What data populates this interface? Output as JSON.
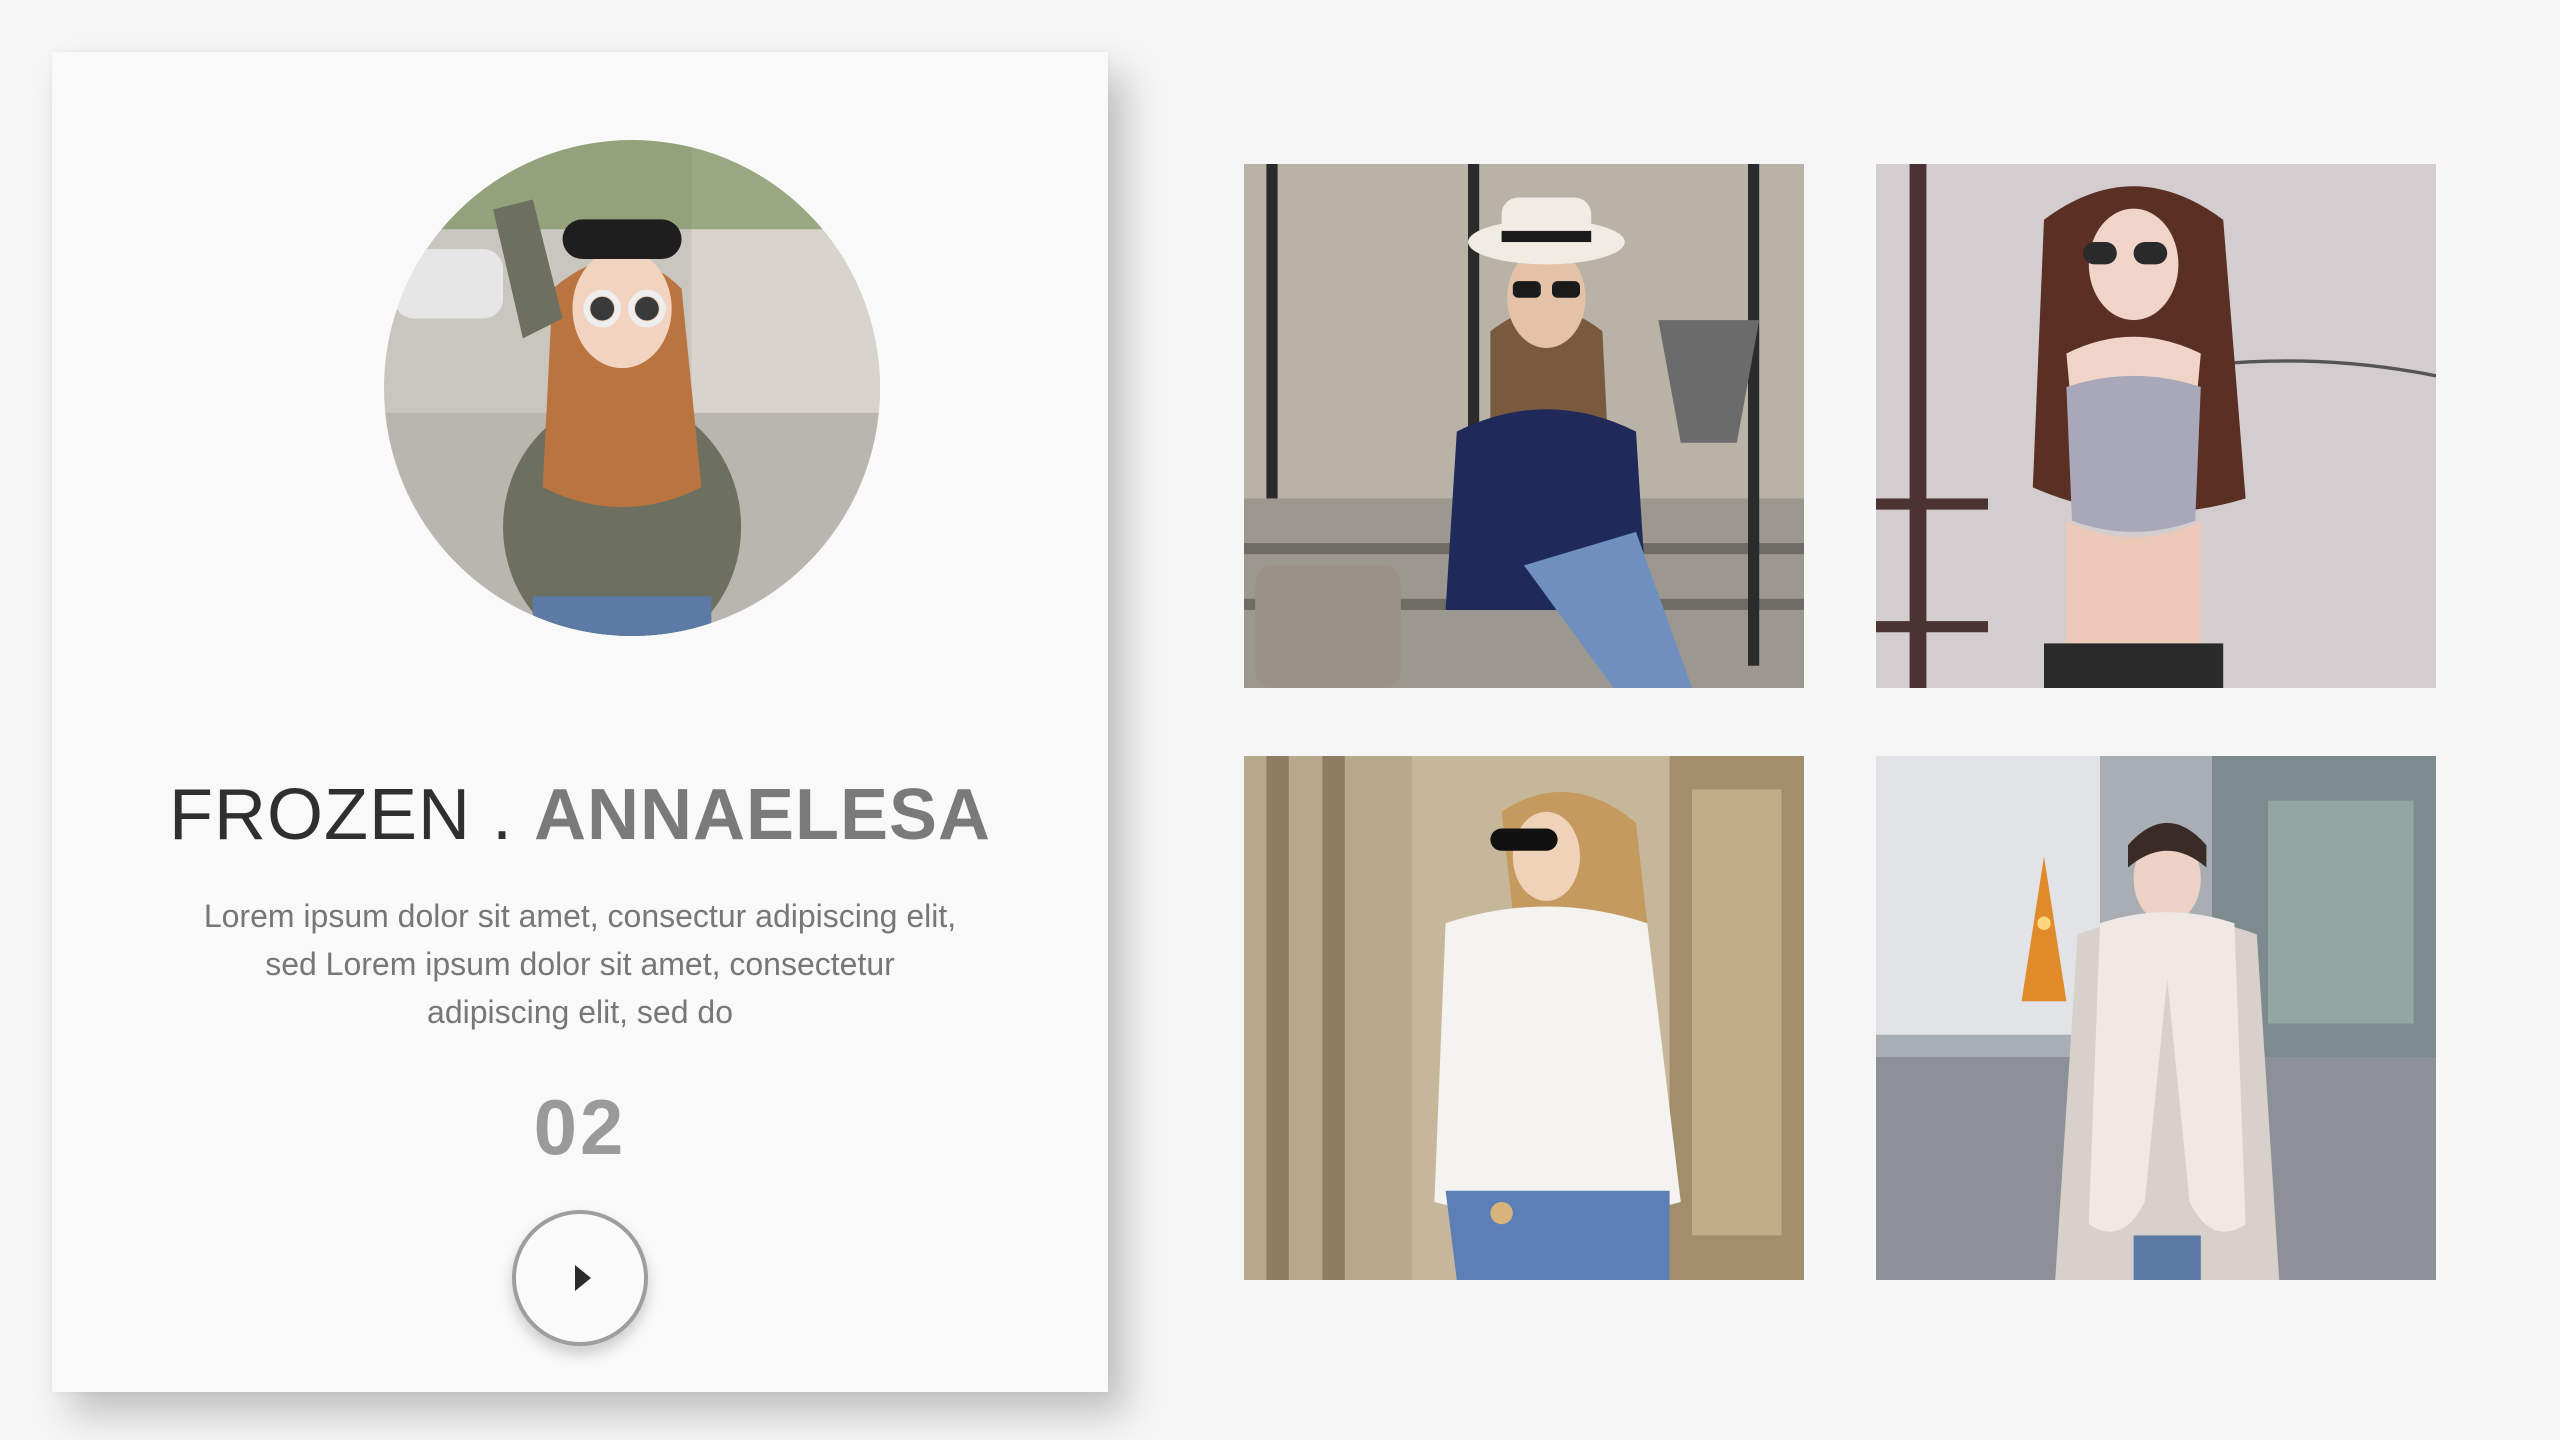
{
  "profile": {
    "title_light": "FROZEN . ",
    "title_bold": "ANNAELESA",
    "description": "Lorem ipsum dolor sit amet, consectur adipiscing elit, sed Lorem ipsum dolor sit amet, consectetur adipiscing elit, sed do",
    "number": "02",
    "avatar_icon": "avatar-photo",
    "play_icon": "play-icon"
  },
  "gallery": {
    "photos": [
      {
        "name": "photo-hat-woman"
      },
      {
        "name": "photo-crop-top-woman"
      },
      {
        "name": "photo-white-shirt-woman"
      },
      {
        "name": "photo-fur-scarf-woman"
      }
    ]
  },
  "colors": {
    "background": "#f6f6f6",
    "card": "#f9f9f9",
    "title_light": "#2f2f2f",
    "title_bold": "#7a7a7a",
    "description": "#777777",
    "number": "#9a9a9a"
  }
}
